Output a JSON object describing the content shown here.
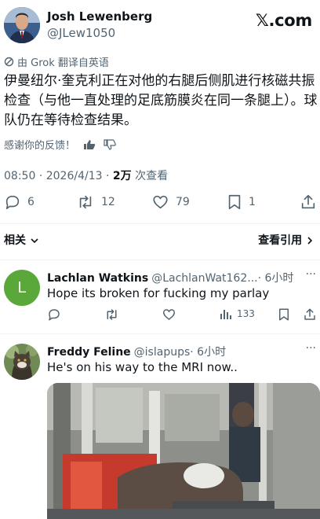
{
  "post": {
    "author_name": "Josh Lewenberg",
    "author_handle": "@JLew1050",
    "brand": "𝕏.com",
    "translation_note": "由 Grok 翻译自英语",
    "body": "伊曼纽尔·奎克利正在对他的右腿后侧肌进行核磁共振检查（与他一直处理的足底筋膜炎在同一条腿上）。球队仍在等待检查结果。",
    "feedback_prompt": "感谢你的反馈！",
    "time": "08:50",
    "date": "2026/4/13",
    "views": "2万",
    "views_label": "次查看",
    "replies": "6",
    "reposts": "12",
    "likes": "79",
    "bookmarks": "1"
  },
  "filters": {
    "relevant": "相关",
    "quotes": "查看引用"
  },
  "replies": [
    {
      "name": "Lachlan Watkins",
      "handle": "@LachlanWat162...",
      "time": "· 6小时",
      "text": "Hope its broken for fucking my parlay",
      "views": "133",
      "avatar_letter": "L",
      "avatar_color": "#5aa83a"
    },
    {
      "name": "Freddy Feline",
      "handle": "@islapups",
      "time": "· 6小时",
      "text": "He's on his way to the MRI now.."
    }
  ],
  "colors": {
    "text": "#0f1419",
    "secondary": "#536471",
    "divider": "#eff3f4"
  }
}
